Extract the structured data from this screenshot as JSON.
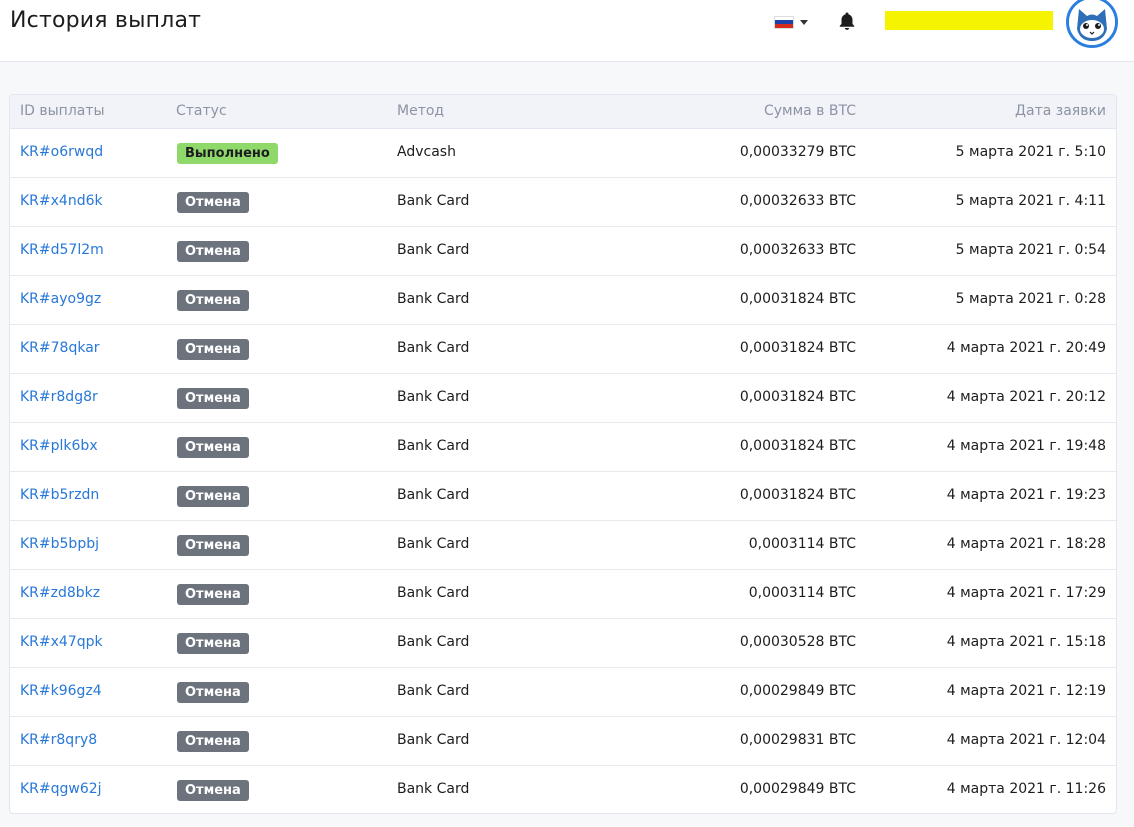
{
  "header": {
    "title": "История выплат",
    "language_flag": "russia-flag-icon",
    "notification_icon": "bell-icon",
    "user_name": ""
  },
  "colors": {
    "link": "#2778d8",
    "done_badge": "#8fd96b",
    "cancel_badge": "#6c737d",
    "user_highlight": "#f5f300"
  },
  "table": {
    "columns": [
      "ID выплаты",
      "Статус",
      "Метод",
      "Сумма в BTC",
      "Дата заявки"
    ],
    "rows": [
      {
        "id": "KR#o6rwqd",
        "status": "Выполнено",
        "status_type": "done",
        "method": "Advcash",
        "amount": "0,00033279 BTC",
        "date": "5 марта 2021 г. 5:10"
      },
      {
        "id": "KR#x4nd6k",
        "status": "Отмена",
        "status_type": "cancel",
        "method": "Bank Card",
        "amount": "0,00032633 BTC",
        "date": "5 марта 2021 г. 4:11"
      },
      {
        "id": "KR#d57l2m",
        "status": "Отмена",
        "status_type": "cancel",
        "method": "Bank Card",
        "amount": "0,00032633 BTC",
        "date": "5 марта 2021 г. 0:54"
      },
      {
        "id": "KR#ayo9gz",
        "status": "Отмена",
        "status_type": "cancel",
        "method": "Bank Card",
        "amount": "0,00031824 BTC",
        "date": "5 марта 2021 г. 0:28"
      },
      {
        "id": "KR#78qkar",
        "status": "Отмена",
        "status_type": "cancel",
        "method": "Bank Card",
        "amount": "0,00031824 BTC",
        "date": "4 марта 2021 г. 20:49"
      },
      {
        "id": "KR#r8dg8r",
        "status": "Отмена",
        "status_type": "cancel",
        "method": "Bank Card",
        "amount": "0,00031824 BTC",
        "date": "4 марта 2021 г. 20:12"
      },
      {
        "id": "KR#plk6bx",
        "status": "Отмена",
        "status_type": "cancel",
        "method": "Bank Card",
        "amount": "0,00031824 BTC",
        "date": "4 марта 2021 г. 19:48"
      },
      {
        "id": "KR#b5rzdn",
        "status": "Отмена",
        "status_type": "cancel",
        "method": "Bank Card",
        "amount": "0,00031824 BTC",
        "date": "4 марта 2021 г. 19:23"
      },
      {
        "id": "KR#b5bpbj",
        "status": "Отмена",
        "status_type": "cancel",
        "method": "Bank Card",
        "amount": "0,0003114 BTC",
        "date": "4 марта 2021 г. 18:28"
      },
      {
        "id": "KR#zd8bkz",
        "status": "Отмена",
        "status_type": "cancel",
        "method": "Bank Card",
        "amount": "0,0003114 BTC",
        "date": "4 марта 2021 г. 17:29"
      },
      {
        "id": "KR#x47qpk",
        "status": "Отмена",
        "status_type": "cancel",
        "method": "Bank Card",
        "amount": "0,00030528 BTC",
        "date": "4 марта 2021 г. 15:18"
      },
      {
        "id": "KR#k96gz4",
        "status": "Отмена",
        "status_type": "cancel",
        "method": "Bank Card",
        "amount": "0,00029849 BTC",
        "date": "4 марта 2021 г. 12:19"
      },
      {
        "id": "KR#r8qry8",
        "status": "Отмена",
        "status_type": "cancel",
        "method": "Bank Card",
        "amount": "0,00029831 BTC",
        "date": "4 марта 2021 г. 12:04"
      },
      {
        "id": "KR#qgw62j",
        "status": "Отмена",
        "status_type": "cancel",
        "method": "Bank Card",
        "amount": "0,00029849 BTC",
        "date": "4 марта 2021 г. 11:26"
      }
    ]
  }
}
